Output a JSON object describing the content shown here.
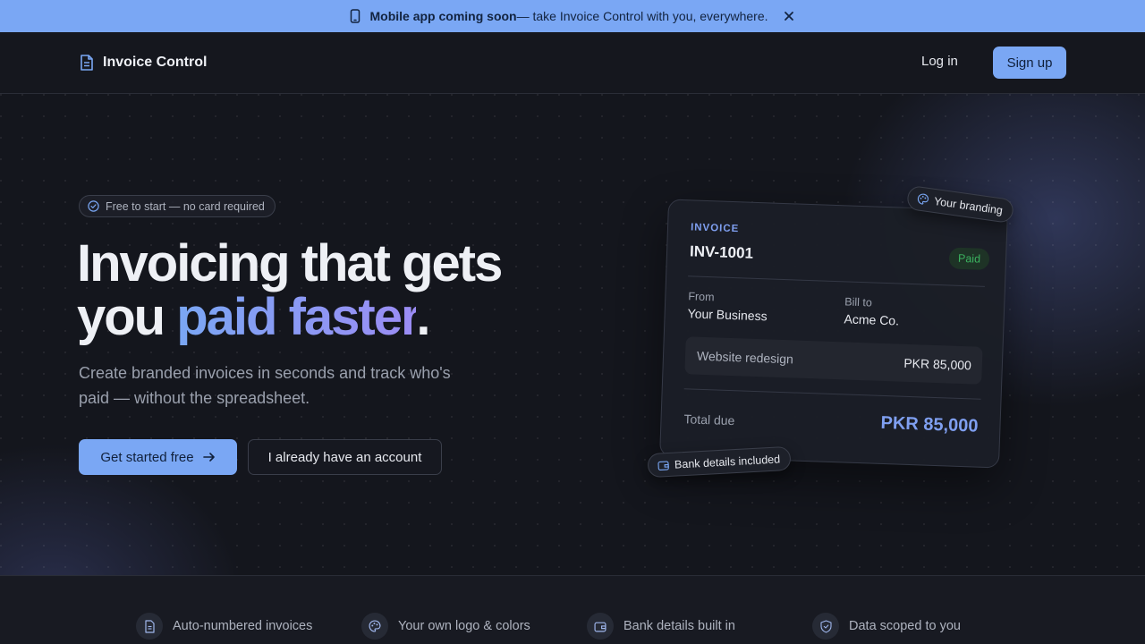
{
  "banner": {
    "icon": "smartphone-icon",
    "strong": "Mobile app coming soon",
    "text": " — take Invoice Control with you, everywhere.",
    "close_icon": "close-icon"
  },
  "nav": {
    "brand": "Invoice Control",
    "brand_icon": "document-icon",
    "login": "Log in",
    "signup": "Sign up"
  },
  "hero": {
    "pill": "Free to start — no card required",
    "pill_icon": "check-circle-icon",
    "headline_line1": "Invoicing that gets",
    "headline_line2_start": "you ",
    "headline_accent": "paid faster",
    "headline_end": ".",
    "subtitle": "Create branded invoices in seconds and track who's paid — without the spreadsheet.",
    "primary_button": "Get started free",
    "primary_icon": "arrow-right-icon",
    "secondary_button": "I already have an account"
  },
  "invoice": {
    "kicker": "INVOICE",
    "number": "INV-1001",
    "status": "Paid",
    "from_label": "From",
    "from_value": "Your Business",
    "to_label": "Bill to",
    "to_value": "Acme Co.",
    "line_description": "Website redesign",
    "line_amount": "PKR 85,000",
    "total_label": "Total due",
    "total_value": "PKR 85,000"
  },
  "tags": {
    "branding": "Your branding",
    "branding_icon": "palette-icon",
    "bank": "Bank details included",
    "bank_icon": "wallet-icon"
  },
  "features": [
    {
      "label": "Auto-numbered invoices",
      "icon": "document-icon"
    },
    {
      "label": "Your own logo & colors",
      "icon": "palette-icon"
    },
    {
      "label": "Bank details built in",
      "icon": "wallet-icon"
    },
    {
      "label": "Data scoped to you",
      "icon": "shield-check-icon"
    }
  ],
  "colors": {
    "accent": "#7aa7f4",
    "accent_gradient_end": "#9b8cf4",
    "background": "#14161d",
    "paid_green": "#3bb25f"
  }
}
